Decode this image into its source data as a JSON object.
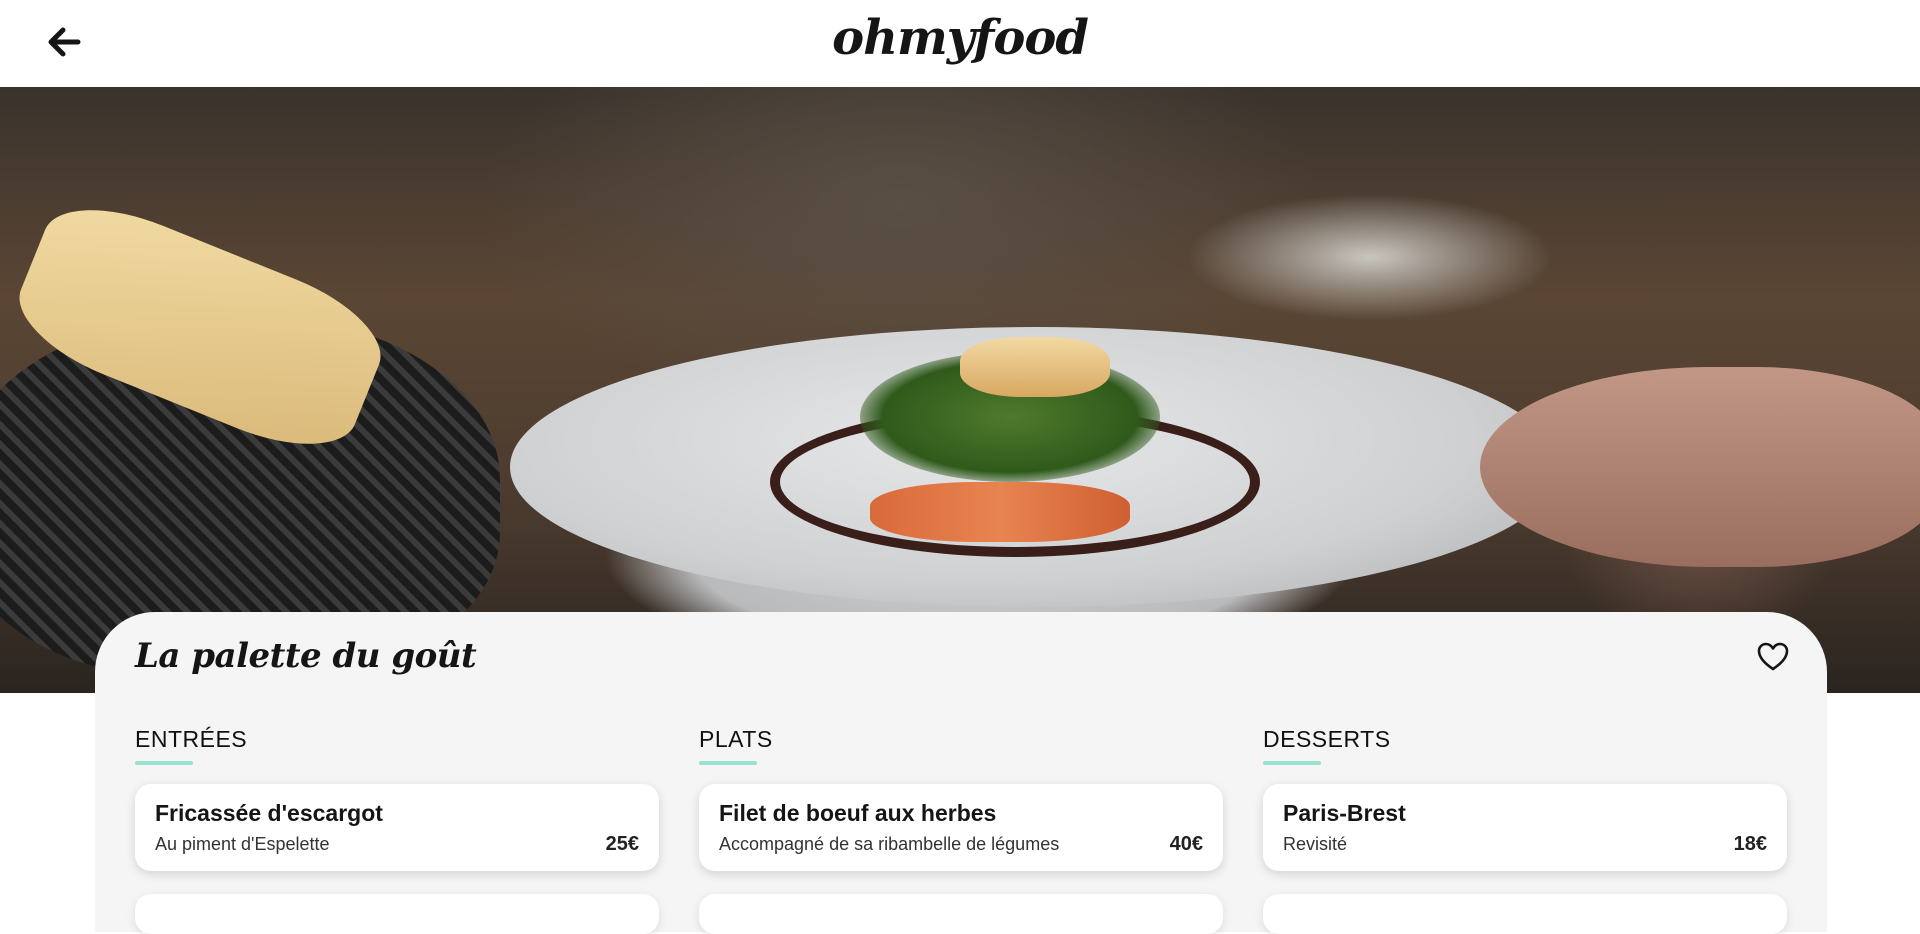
{
  "header": {
    "logo": "ohmyfood",
    "back_icon": "arrow-left-icon"
  },
  "hero": {
    "image_icon": "restaurant-photo"
  },
  "restaurant": {
    "name": "La palette du goût",
    "favorite_icon": "heart-icon"
  },
  "menu": {
    "sections": [
      {
        "heading": "ENTRÉES",
        "dish": {
          "name": "Fricassée d'escargot",
          "description": "Au piment d'Espelette",
          "price": "25€"
        }
      },
      {
        "heading": "PLATS",
        "dish": {
          "name": "Filet de boeuf aux herbes",
          "description": "Accompagné de sa ribambelle de légumes",
          "price": "40€"
        }
      },
      {
        "heading": "DESSERTS",
        "dish": {
          "name": "Paris-Brest",
          "description": "Revisité",
          "price": "18€"
        }
      }
    ]
  },
  "colors": {
    "accent_underline": "#99e2d0",
    "card_background": "#f5f5f5",
    "text": "#151515"
  }
}
